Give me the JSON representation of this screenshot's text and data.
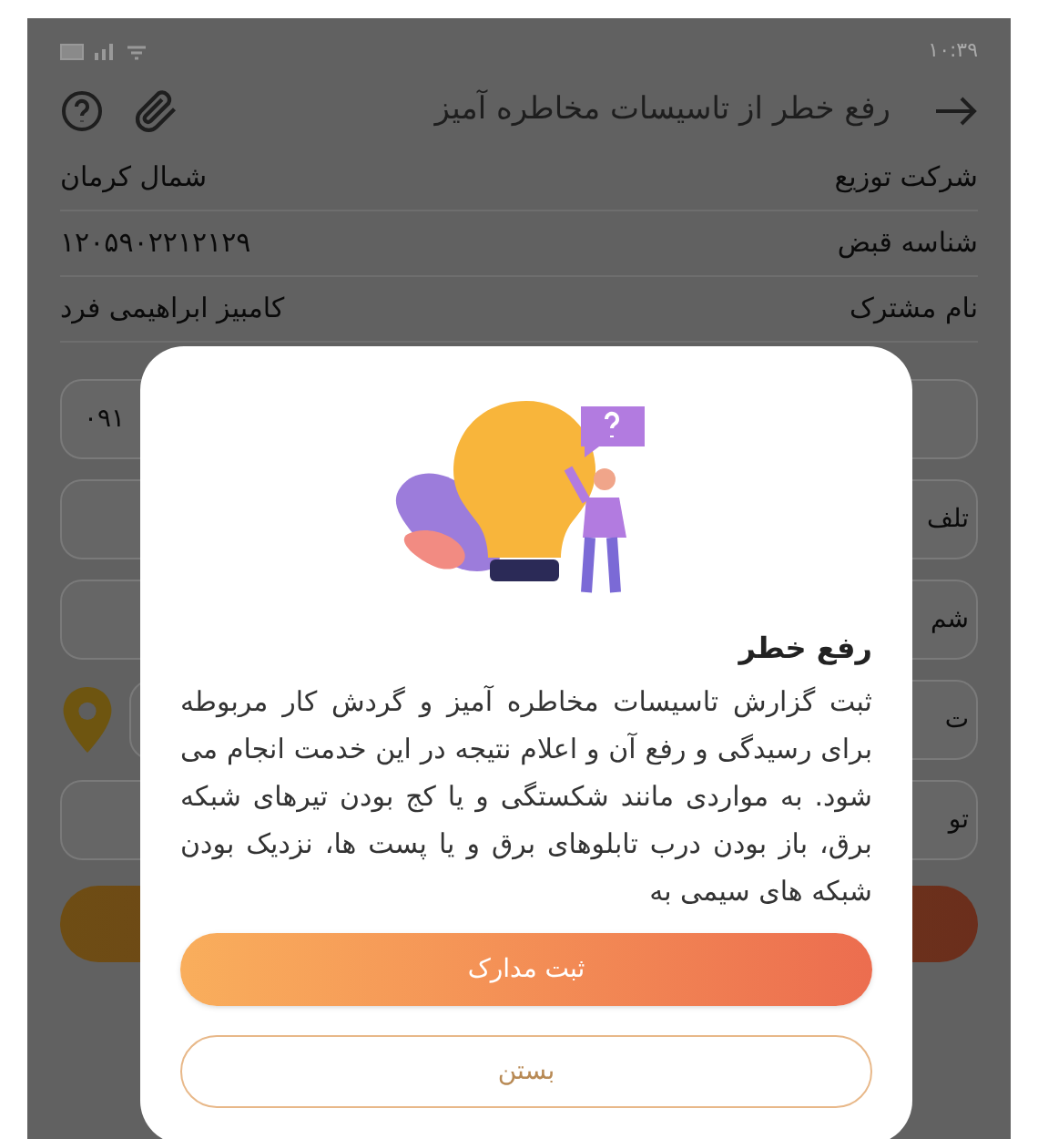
{
  "status_bar": {
    "time": "۱۰:۳۹"
  },
  "header": {
    "title": "رفع خطر از تاسیسات مخاطره آمیز"
  },
  "info_rows": [
    {
      "label": "شرکت توزیع",
      "value": "شمال کرمان"
    },
    {
      "label": "شناسه قبض",
      "value": "۱۲۰۵۹۰۲۲۱۲۱۲۹"
    },
    {
      "label": "نام مشترک",
      "value": "کامبیز ابراهیمی فرد"
    }
  ],
  "fields": [
    {
      "kind": "value",
      "text": "۰۹۱"
    },
    {
      "kind": "label",
      "text": "تلف"
    },
    {
      "kind": "label",
      "text": "شم"
    },
    {
      "kind": "location",
      "text": "ت"
    },
    {
      "kind": "label",
      "text": "تو"
    }
  ],
  "dialog": {
    "title": "رفع خطر",
    "body": "ثبت گزارش تاسیسات مخاطره آمیز و گردش کار مربوطه برای رسیدگی و رفع آن و اعلام نتیجه در این خدمت انجام می شود. به مواردی مانند شکستگی و یا کج بودن تیرهای شبکه برق، باز بودن درب تابلوهای برق و یا پست ها، نزدیک بودن شبکه های سیمی به",
    "primary_button": "ثبت مدارک",
    "secondary_button": "بستن"
  }
}
